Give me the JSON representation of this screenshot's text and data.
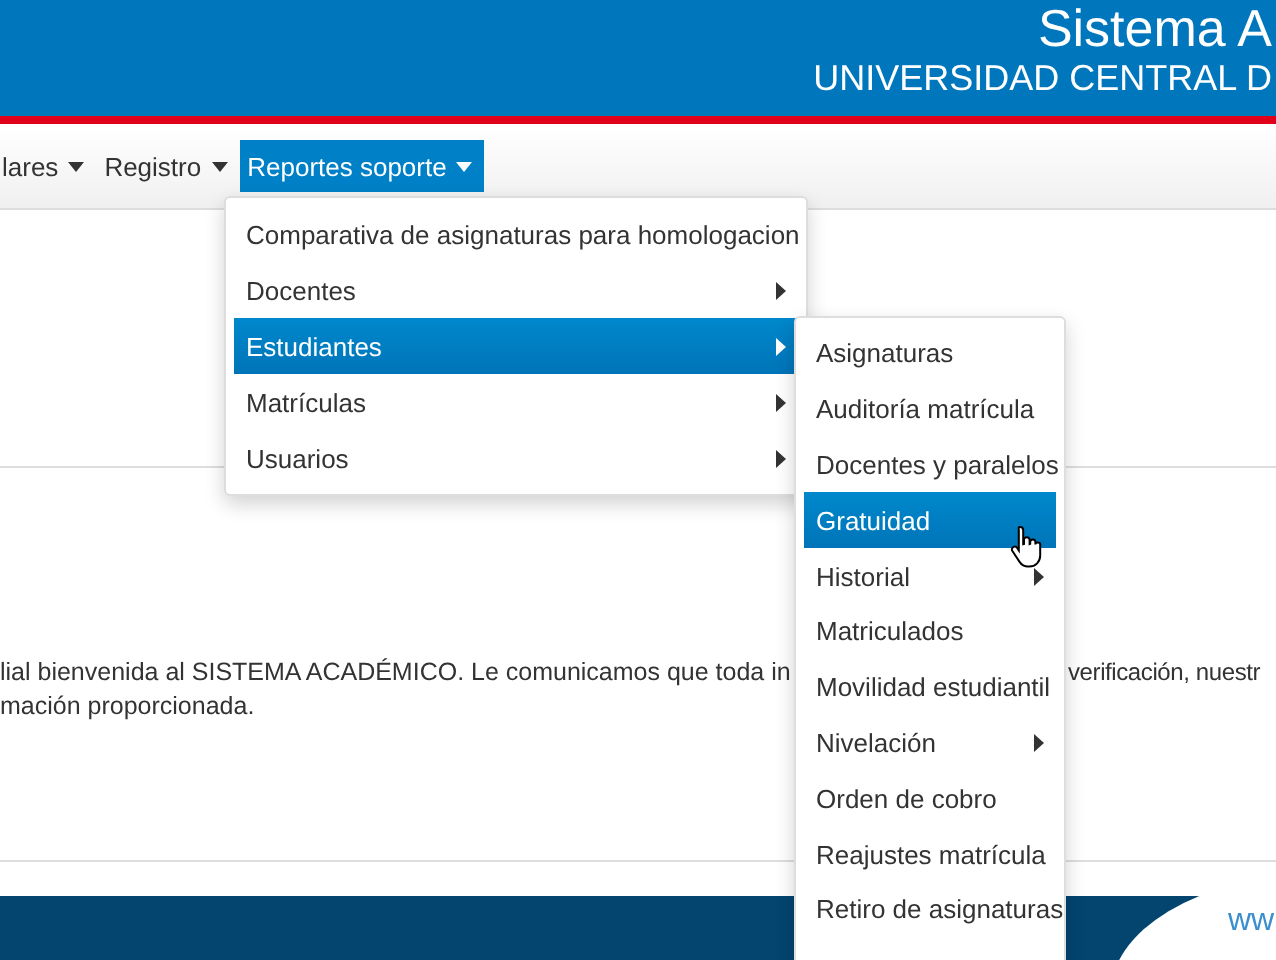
{
  "header": {
    "title": "Sistema A",
    "subtitle": "UNIVERSIDAD CENTRAL D"
  },
  "navbar": [
    {
      "label": "lares",
      "selected": false
    },
    {
      "label": "Registro",
      "selected": false
    },
    {
      "label": "Reportes soporte",
      "selected": true
    }
  ],
  "menu": [
    {
      "label": "Comparativa de asignaturas para homologacion",
      "submenu": false,
      "selected": false
    },
    {
      "label": "Docentes",
      "submenu": true,
      "selected": false
    },
    {
      "label": "Estudiantes",
      "submenu": true,
      "selected": true
    },
    {
      "label": "Matrículas",
      "submenu": true,
      "selected": false
    },
    {
      "label": "Usuarios",
      "submenu": true,
      "selected": false
    }
  ],
  "submenu": [
    {
      "label": "Asignaturas",
      "submenu": false,
      "selected": false
    },
    {
      "label": "Auditoría matrícula",
      "submenu": false,
      "selected": false
    },
    {
      "label": "Docentes y paralelos",
      "submenu": false,
      "selected": false
    },
    {
      "label": "Gratuidad",
      "submenu": false,
      "selected": true
    },
    {
      "label": "Historial",
      "submenu": true,
      "selected": false
    },
    {
      "label": "Matriculados",
      "submenu": false,
      "selected": false
    },
    {
      "label": "Movilidad estudiantil",
      "submenu": false,
      "selected": false
    },
    {
      "label": "Nivelación",
      "submenu": true,
      "selected": false
    },
    {
      "label": "Orden de cobro",
      "submenu": false,
      "selected": false
    },
    {
      "label": "Reajustes matrícula",
      "submenu": false,
      "selected": false
    },
    {
      "label": "Retiro de asignaturas",
      "submenu": false,
      "selected": false
    }
  ],
  "welcome": {
    "line_1_left": "lial bienvenida al SISTEMA ACADÉMICO. Le comunicamos que toda in",
    "line_1_right": "verificación, nuestr",
    "line_2": "mación proporcionada."
  },
  "footer": {
    "link": "ww"
  }
}
